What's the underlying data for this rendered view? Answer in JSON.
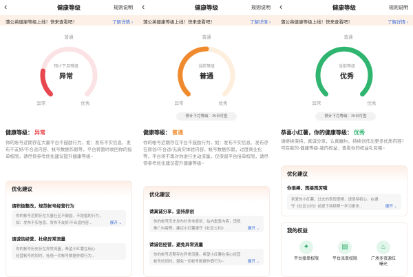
{
  "common": {
    "back_glyph": "‹",
    "title": "健康等级",
    "rules": "规则说明",
    "notice_text": "蒲公英健康等级上线！快来查看吧！",
    "notice_link": "了解详情 ›",
    "level_prefix": "健康等级："
  },
  "panel1": {
    "gauge_top": "普通",
    "gauge_left": "异常",
    "gauge_right": "优秀",
    "gauge_caption": "预计下月等级",
    "gauge_level": "异常",
    "gauge_color": "#e8474f",
    "level_value": "异常",
    "level_color": "#e8474f",
    "desc": "你的账号近期存在大量平台不鼓励行为，如：发布不实信息、发布不友好/不合适内容、帐号数据作假等，平台将暂时收回你的接单权限，请尽快参考优化建议提升健康等级~",
    "card_title": "优化建议",
    "item1_title": "请积极整改，规范帐号经营行为",
    "item1_line1": "你的帐号近期存在大量社区不鼓励、不提倡的行为，",
    "item1_line2": "如：发布不实信息、发布不友好/不合适内容...",
    "item1_expand": "展开 ⌄",
    "item2_title": "请诚信经营，杜绝异常流量",
    "item2_line1": "你的帐号历史存在异常流量，希望小红薯在用心",
    "item2_line2": "经营帐号的同时，杜绝一切帐号数据作假行为..."
  },
  "panel2": {
    "gauge_top": "普通",
    "gauge_left": "异常",
    "gauge_right": "优秀",
    "gauge_caption": "当前等级",
    "gauge_level": "普通",
    "gauge_color": "#f08a2e",
    "pill": "预计下月等级：25日可查",
    "level_value": "普通",
    "level_color": "#f08a2e",
    "desc": "你的帐号近期存在平台不鼓励行为，如：发布不实信息、发布存在原创/不合适/无真实体验内容，帐号数据作假，过度商业化等，平台将不再对你进行主动流量，仅保留平台接单权限，请尽快参考优化建议提升健康等级~",
    "card_title": "优化建议",
    "item1_title": "请真诚分享，坚持原创",
    "item1_line1": "你的帐号历史发布抄多非原创、站内重复内容，违规",
    "item1_line2": "推广内容等，建议小红薯遵守《社区公约》...",
    "item1_expand": "展开 ⌄",
    "item2_title": "请诚信经营，避免异常流量",
    "item2_line1": "你的帐号近期存在异常流量，希望小红薯在用心经营",
    "item2_line2": "帐号的同时，避免一切帐号数据作假行为~",
    "item2_expand": "展开 ⌄"
  },
  "panel3": {
    "gauge_top": "普通",
    "gauge_left": "异常",
    "gauge_right": "优秀",
    "gauge_caption": "当前等级",
    "gauge_level": "优秀",
    "gauge_color": "#2fb56f",
    "pill": "预计下月等级：25日可查",
    "level_prefix": "恭喜小红薯，你的健康等级：",
    "level_value": "优秀",
    "level_color": "#2fb56f",
    "desc": "请继续保持，真诚分享，认真履约，持续创作出更多优质内容！可在我的-健康等级-我的权益，查看你的权益礼包哦~",
    "card_title": "优化建议",
    "item1_title": "你很棒，再接再厉哦",
    "item1_line1": "亲爱的小红薯，过去的表现很棒，请坚持初心，在遵",
    "item1_line2": "守《社区公约》前提下持续帮一学习更多...",
    "item1_expand": "展开 ⌄",
    "perks_title": "我的权益",
    "perks": [
      {
        "icon": "handshake-icon",
        "glyph": "✦",
        "label": "平台接单权限"
      },
      {
        "icon": "order-icon",
        "glyph": "▤",
        "label": "平台派单权限"
      },
      {
        "icon": "fire-icon",
        "glyph": "♨",
        "label": "广场多资源位曝光"
      }
    ]
  }
}
